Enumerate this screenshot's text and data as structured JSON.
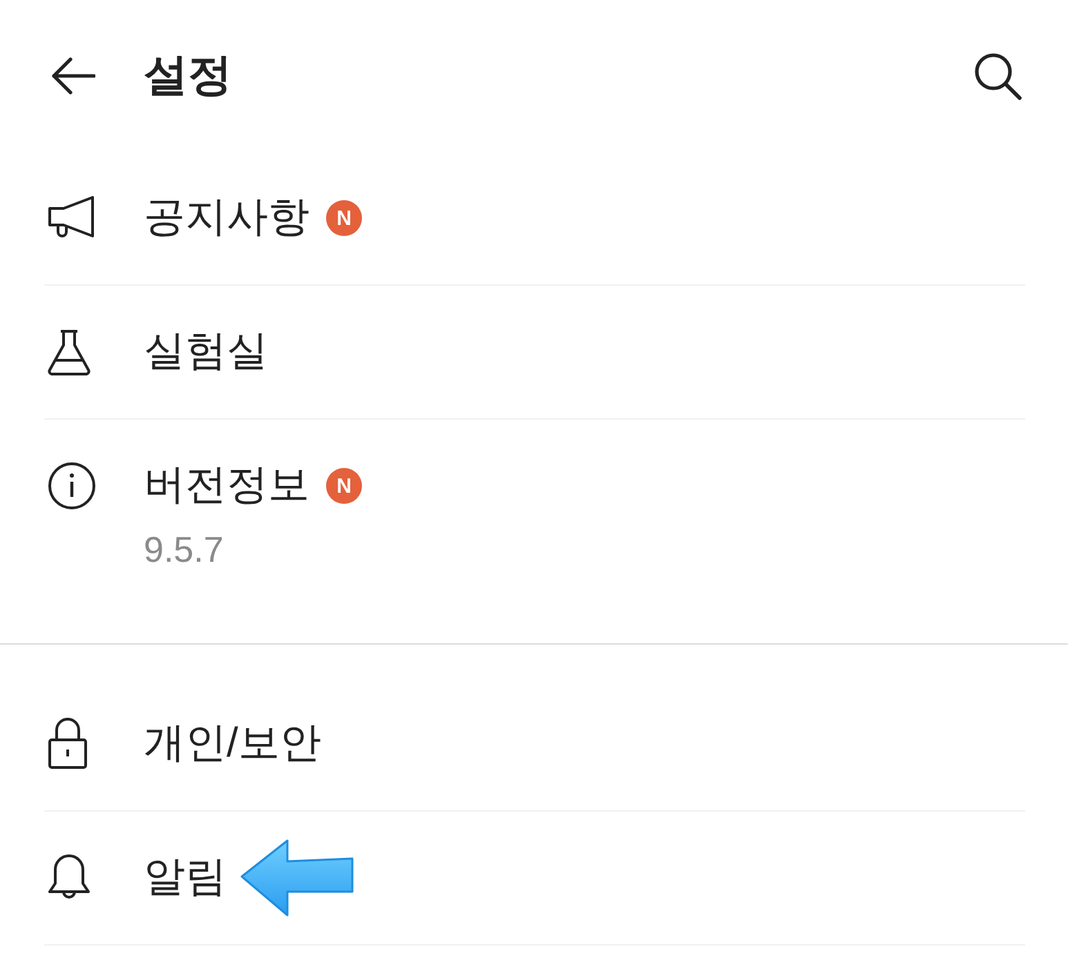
{
  "header": {
    "title": "설정"
  },
  "sections": [
    {
      "items": [
        {
          "kind": "megaphone",
          "label": "공지사항",
          "badge": "N"
        },
        {
          "kind": "flask",
          "label": "실험실"
        },
        {
          "kind": "info",
          "label": "버전정보",
          "badge": "N",
          "subtitle": "9.5.7"
        }
      ]
    },
    {
      "items": [
        {
          "kind": "lock",
          "label": "개인/보안"
        },
        {
          "kind": "bell",
          "label": "알림",
          "pointer_arrow": true
        }
      ]
    }
  ]
}
